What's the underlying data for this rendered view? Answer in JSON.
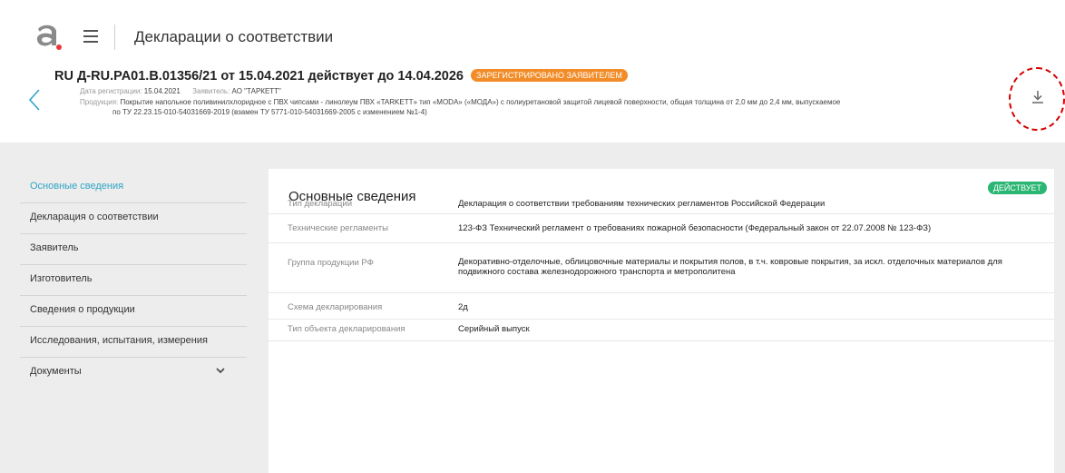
{
  "app": {
    "title": "Декларации о соответствии",
    "logo_icon": "logo-icon",
    "menu_icon": "hamburger-icon"
  },
  "header": {
    "doc_number_title": "RU Д-RU.PA01.B.01356/21 от 15.04.2021 действует до 14.04.2026",
    "status_badge": "ЗАРЕГИСТРИРОВАНО ЗАЯВИТЕЛЕМ",
    "reg_date_label": "Дата регистрации:",
    "reg_date": "15.04.2021",
    "applicant_label": "Заявитель:",
    "applicant": "АО \"ТАРКЕТТ\"",
    "product_label": "Продукция:",
    "product_line1": "Покрытие напольное поливинилхлоридное с ПВХ чипсами - линолеум ПВХ «TARKETT» тип «MODA» («МОДА») с полиуретановой защитой лицевой поверхности, общая толщина от 2,0 мм до 2,4 мм, выпускаемое",
    "product_line2": "по ТУ 22.23.15-010-54031669-2019 (взамен ТУ 5771-010-54031669-2005 с изменением №1-4)",
    "back_icon": "chevron-left-icon",
    "download_icon": "download-icon"
  },
  "sidebar": {
    "items": [
      {
        "label": "Основные сведения",
        "active": true
      },
      {
        "label": "Декларация о соответствии"
      },
      {
        "label": "Заявитель"
      },
      {
        "label": "Изготовитель"
      },
      {
        "label": "Сведения о продукции"
      },
      {
        "label": "Исследования, испытания, измерения"
      },
      {
        "label": "Документы",
        "icon": "chevron-down-icon"
      }
    ]
  },
  "main": {
    "title": "Основные сведения",
    "status_badge": "ДЕЙСТВУЕТ",
    "rows": [
      {
        "label": "Тип декларации",
        "value": "Декларация о соответствии требованиям технических регламентов Российской Федерации"
      },
      {
        "label": "Технические регламенты",
        "value": "123-ФЗ Технический регламент о требованиях пожарной безопасности (Федеральный закон от 22.07.2008 № 123-ФЗ)"
      },
      {
        "label": "Группа продукции РФ",
        "value": "Декоративно-отделочные, облицовочные материалы и покрытия полов, в т.ч. ковровые покрытия, за искл. отделочных материалов для подвижного состава железнодорожного транспорта и метрополитена"
      },
      {
        "label": "Схема декларирования",
        "value": "2д"
      },
      {
        "label": "Тип объекта декларирования",
        "value": "Серийный выпуск"
      }
    ]
  },
  "colors": {
    "accent": "#2fa4c7",
    "orange_badge": "#f28c28",
    "green_badge": "#2bb673",
    "logo_gray": "#8a8a8a",
    "logo_red": "#e8373c"
  }
}
